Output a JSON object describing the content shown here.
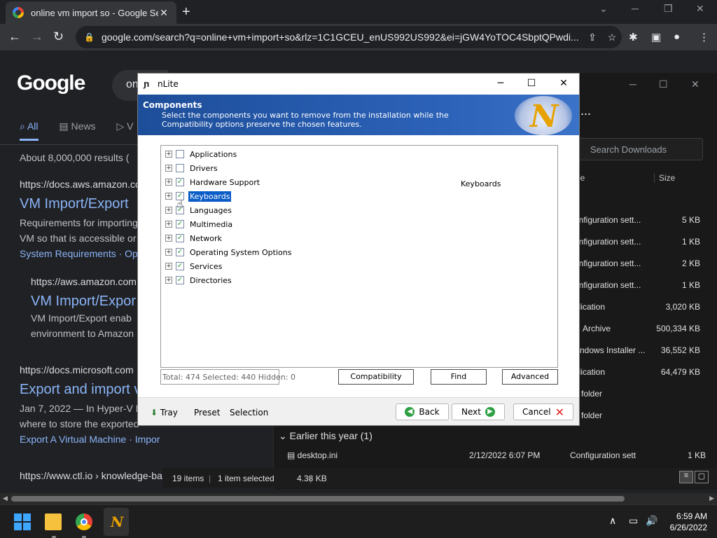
{
  "browser": {
    "tab_title": "online vm import so - Google Se",
    "new_tab": "+",
    "url": "google.com/search?q=online+vm+import+so&rlz=1C1GCEU_enUS992US992&ei=jGW4YoTOC4SbptQPwdi...",
    "controls": {
      "minimize": "─",
      "restore": "❐",
      "close": "✕",
      "chevron": "⌄"
    }
  },
  "google": {
    "logo": "Google",
    "query_partial": "on",
    "tabs": [
      {
        "label": "All"
      },
      {
        "label": "News"
      },
      {
        "label": "V"
      }
    ],
    "result_count": "About 8,000,000 results (",
    "results": [
      {
        "cite": "https://docs.aws.amazon.co",
        "title": "VM Import/Export",
        "line1": "Requirements for importing",
        "line2": "VM so that is accessible or",
        "links": "System Requirements · Ope"
      },
      {
        "cite": "https://aws.amazon.com",
        "title": "VM Import/Expor",
        "line1": "VM Import/Export enab",
        "line2": "environment to Amazon"
      },
      {
        "cite": "https://docs.microsoft.com",
        "title": "Export and import v",
        "line1": "Jan 7, 2022 — In Hyper-V M",
        "line2": "where to store the exported",
        "links": "Export A Virtual Machine · Impor"
      },
      {
        "cite": "https://www.ctl.io › knowledge-ba"
      }
    ]
  },
  "explorer": {
    "search_placeholder": "Search Downloads",
    "columns": {
      "type": "pe",
      "size": "Size"
    },
    "rows": [
      {
        "type": "onfiguration sett...",
        "size": "5 KB"
      },
      {
        "type": "onfiguration sett...",
        "size": "1 KB"
      },
      {
        "type": "onfiguration sett...",
        "size": "2 KB"
      },
      {
        "type": "onfiguration sett...",
        "size": "1 KB"
      },
      {
        "type": "plication",
        "size": "3,020 KB"
      },
      {
        "type": "Archive",
        "size": "500,334 KB"
      },
      {
        "type": "ndows Installer ...",
        "size": "36,552 KB"
      },
      {
        "type": "plication",
        "size": "64,479 KB"
      },
      {
        "type": "e folder",
        "size": ""
      },
      {
        "type": "e folder",
        "size": ""
      }
    ],
    "earlier_group": "Earlier this year (1)",
    "earlier_file": {
      "name": "desktop.ini",
      "date": "2/12/2022 6:07 PM",
      "type": "Configuration sett",
      "size": "1 KB"
    },
    "status": {
      "items": "19 items",
      "selected": "1 item selected",
      "size": "4.38 KB"
    },
    "more": "..."
  },
  "nlite": {
    "title": "nLite",
    "banner_heading": "Components",
    "banner_description": "Select the components you want to remove from the installation while the Compatibility options preserve the chosen features.",
    "tree": [
      {
        "label": "Applications",
        "checked": false
      },
      {
        "label": "Drivers",
        "checked": false
      },
      {
        "label": "Hardware Support",
        "checked": true
      },
      {
        "label": "Keyboards",
        "checked": true,
        "selected": true
      },
      {
        "label": "Languages",
        "checked": true
      },
      {
        "label": "Multimedia",
        "checked": true
      },
      {
        "label": "Network",
        "checked": true
      },
      {
        "label": "Operating System Options",
        "checked": true
      },
      {
        "label": "Services",
        "checked": true
      },
      {
        "label": "Directories",
        "checked": true
      }
    ],
    "description_label": "Keyboards",
    "totals": "Total: 474 Selected: 440 Hidden: 0",
    "buttons": {
      "compatibility": "Compatibility",
      "find": "Find",
      "advanced": "Advanced"
    },
    "bottom": {
      "tray": "Tray",
      "preset": "Preset",
      "selection": "Selection",
      "back": "Back",
      "next": "Next",
      "cancel": "Cancel"
    }
  },
  "taskbar": {
    "time": "6:59 AM",
    "date": "6/26/2022"
  }
}
